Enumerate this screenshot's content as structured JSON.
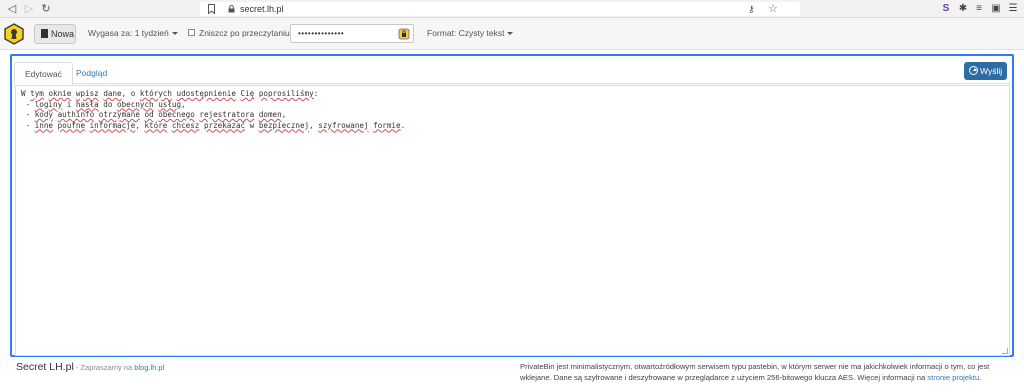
{
  "browser": {
    "url": "secret.lh.pl",
    "ext_badge": "S"
  },
  "toolbar": {
    "new_label": "Nowa",
    "expire_label": "Wygasa za: 1 tydzień",
    "burn_label": "Zniszcz po przeczytaniu",
    "password_value": "••••••••••••••",
    "format_label": "Format: Czysty tekst"
  },
  "panel": {
    "tab_edit": "Edytować",
    "tab_preview": "Podgląd",
    "send_label": "Wyślij",
    "lines": [
      [
        "W ",
        "~tym",
        " ",
        "~oknie",
        " ",
        "~wpisz",
        " ",
        "~dane",
        ", o ",
        "~których",
        " ",
        "~udostępnienie",
        " ",
        "~Cię",
        " ",
        "~poprosiliśmy",
        ":"
      ],
      [
        " - ",
        "~loginy",
        " i ",
        "~hasła",
        " do ",
        "~obecnych",
        " ",
        "~usług",
        ","
      ],
      [
        " - ",
        "~kody",
        " ",
        "~authinfo",
        " ",
        "~otrzymane",
        " ",
        "~od",
        " ",
        "~obecnego",
        " ",
        "~rejestratora",
        " ",
        "~domen",
        ","
      ],
      [
        " - ",
        "~inne",
        " ",
        "~poufne",
        " ",
        "~informacje",
        ", ",
        "~które",
        " ",
        "~chcesz",
        " ",
        "~przekazać",
        " w ",
        "~bezpiecznej",
        ", ",
        "~szyfrowanej",
        " ",
        "~formie",
        "."
      ]
    ]
  },
  "footer": {
    "brand": "Secret LH.pl",
    "tagline_prefix": " - Zapraszamy na ",
    "tagline_link": "blog.lh.pl",
    "about_text": "PrivateBin jest minimalistycznym, otwartoźródłowym serwisem typu pastebin, w którym serwer nie ma jakichkolwiek informacji o tym, co jest wklejane. Dane są szyfrowane i deszyfrowane w przeglądarce z użyciem 256-bitowego klucza AES. Więcej informacji na ",
    "about_link": "stronie projektu",
    "about_end": "."
  },
  "colors": {
    "accent": "#2f7bf5",
    "send_button": "#2d6da3",
    "link": "#337ab7"
  }
}
